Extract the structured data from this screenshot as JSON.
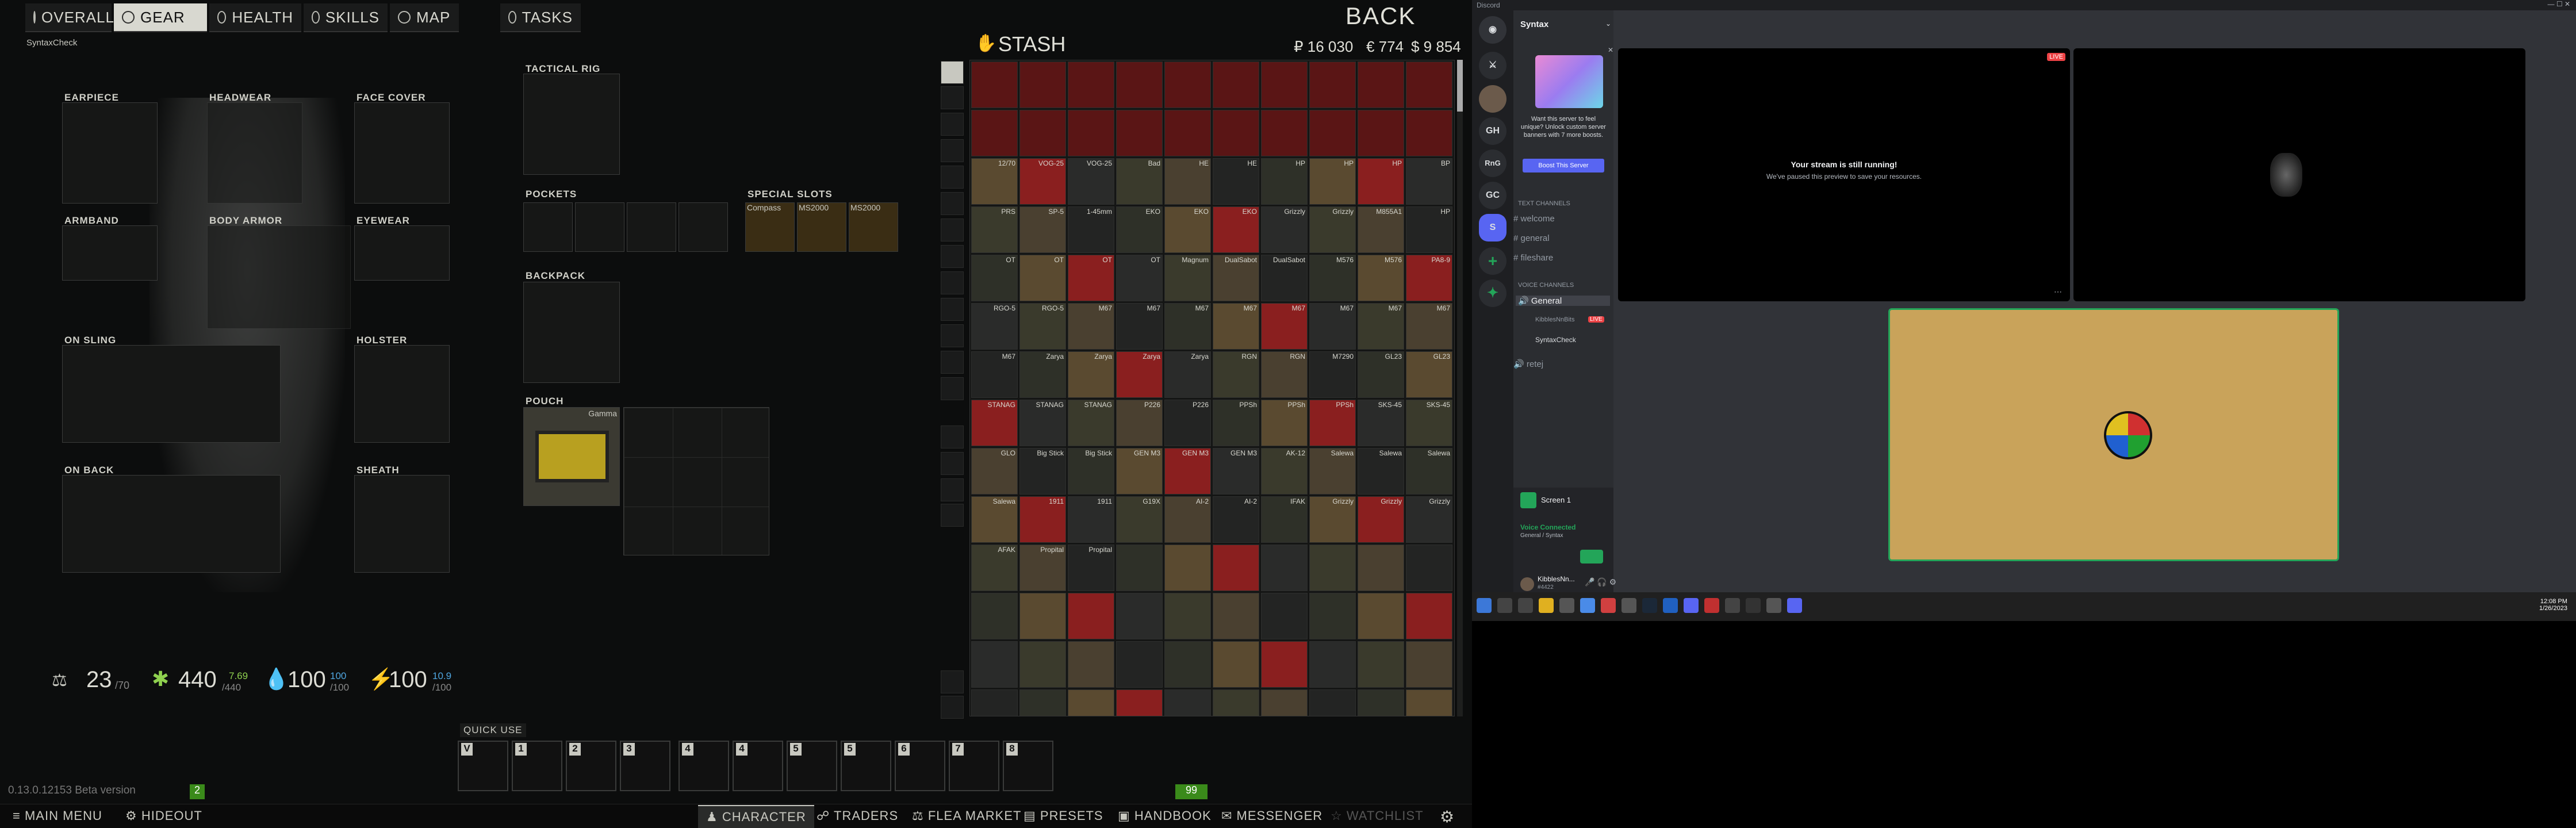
{
  "game": {
    "tabs": [
      "OVERALL",
      "GEAR",
      "HEALTH",
      "SKILLS",
      "MAP",
      "TASKS"
    ],
    "back_label": "BACK",
    "player_name": "SyntaxCheck",
    "slots": {
      "earpiece": "EARPIECE",
      "headwear": "HEADWEAR",
      "face_cover": "FACE COVER",
      "armband": "ARMBAND",
      "body_armor": "BODY ARMOR",
      "eyewear": "EYEWEAR",
      "on_sling": "ON SLING",
      "holster": "HOLSTER",
      "on_back": "ON BACK",
      "sheath": "SHEATH",
      "tactical_rig": "TACTICAL RIG",
      "pockets": "POCKETS",
      "special_slots": "SPECIAL SLOTS",
      "backpack": "BACKPACK",
      "pouch": "POUCH"
    },
    "special_items": [
      "Compass",
      "MS2000",
      "MS2000"
    ],
    "pouch_item": "Gamma",
    "stats": {
      "weight": "23",
      "weight_max": "/70",
      "energy": "440",
      "energy_max": "/440",
      "energy_delta": "7.69",
      "hydration": "100",
      "hydration_max": "/100",
      "hydration_delta": "100",
      "health": "100",
      "health_max": "/100",
      "health_delta": "10.9"
    },
    "stash": {
      "title": "STASH",
      "roubles": "₽ 16 030",
      "euros": "€ 774",
      "dollars": "$ 9 854"
    },
    "stash_labels": [
      "12/70",
      "VOG-25",
      "VOG-25",
      "Bad",
      "HE",
      "HE",
      "HP",
      "HP",
      "HP",
      "BP",
      "PRS",
      "SP-5",
      "1-45mm",
      "EKO",
      "EKO",
      "EKO",
      "Grizzly",
      "Grizzly",
      "M855A1",
      "HP",
      "OT",
      "OT",
      "OT",
      "OT",
      "Magnum",
      "DualSabot",
      "DualSabot",
      "M576",
      "M576",
      "PA8-9",
      "RGO-5",
      "RGO-5",
      "M67",
      "M67",
      "M67",
      "M67",
      "M67",
      "M67",
      "M67",
      "M67",
      "M67",
      "Zarya",
      "Zarya",
      "Zarya",
      "Zarya",
      "RGN",
      "RGN",
      "M7290",
      "GL23",
      "GL23",
      "STANAG",
      "STANAG",
      "STANAG",
      "P226",
      "P226",
      "PPSh",
      "PPSh",
      "PPSh",
      "SKS-45",
      "SKS-45",
      "GLO",
      "Big Stick",
      "Big Stick",
      "GEN M3",
      "GEN M3",
      "GEN M3",
      "AK-12",
      "Salewa",
      "Salewa",
      "Salewa",
      "Salewa",
      "1911",
      "1911",
      "G19X",
      "AI-2",
      "AI-2",
      "IFAK",
      "Grizzly",
      "Grizzly",
      "Grizzly",
      "AFAK",
      "Propital",
      "Propital"
    ],
    "quick_use": "QUICK USE",
    "quick_keys": [
      "V",
      "1",
      "2",
      "3",
      "4",
      "4",
      "5",
      "5",
      "6",
      "7",
      "8"
    ],
    "version": "0.13.0.12153 Beta version",
    "badge_left": "2",
    "badge_right": "99",
    "bottom_nav": [
      "MAIN MENU",
      "HIDEOUT",
      "CHARACTER",
      "TRADERS",
      "FLEA MARKET",
      "PRESETS",
      "HANDBOOK",
      "MESSENGER",
      "WATCHLIST"
    ]
  },
  "discord": {
    "window_title": "Discord",
    "server": "Syntax",
    "server_icons": [
      "GH",
      "RnG",
      "GC",
      "S"
    ],
    "boost_text": "Want this server to feel unique? Unlock custom server banners with 7 more boosts.",
    "boost_button": "Boost This Server",
    "text_channels_label": "TEXT CHANNELS",
    "text_channels": [
      "welcome",
      "general",
      "fileshare"
    ],
    "voice_channels_label": "VOICE CHANNELS",
    "voice_channels": [
      "General",
      "retej"
    ],
    "voice_users": [
      "KibblesNnBits",
      "SyntaxCheck"
    ],
    "live": "LIVE",
    "stream_paused_title": "Your stream is still running!",
    "stream_paused_sub": "We've paused this preview to save your resources.",
    "screen_label": "Screen 1",
    "voice_connected": "Voice Connected",
    "voice_sub": "General / Syntax",
    "user_name": "KibblesNn...",
    "user_tag": "#4422"
  },
  "taskbar": {
    "time": "12:08 PM",
    "date": "1/26/2023"
  },
  "colors": {
    "game_bg": "#0c0d0d",
    "discord_bg": "#313338",
    "accent": "#5865f2",
    "live": "#ed4245",
    "stream_bg": "#c9a35a",
    "rounds": "#c0302b"
  }
}
